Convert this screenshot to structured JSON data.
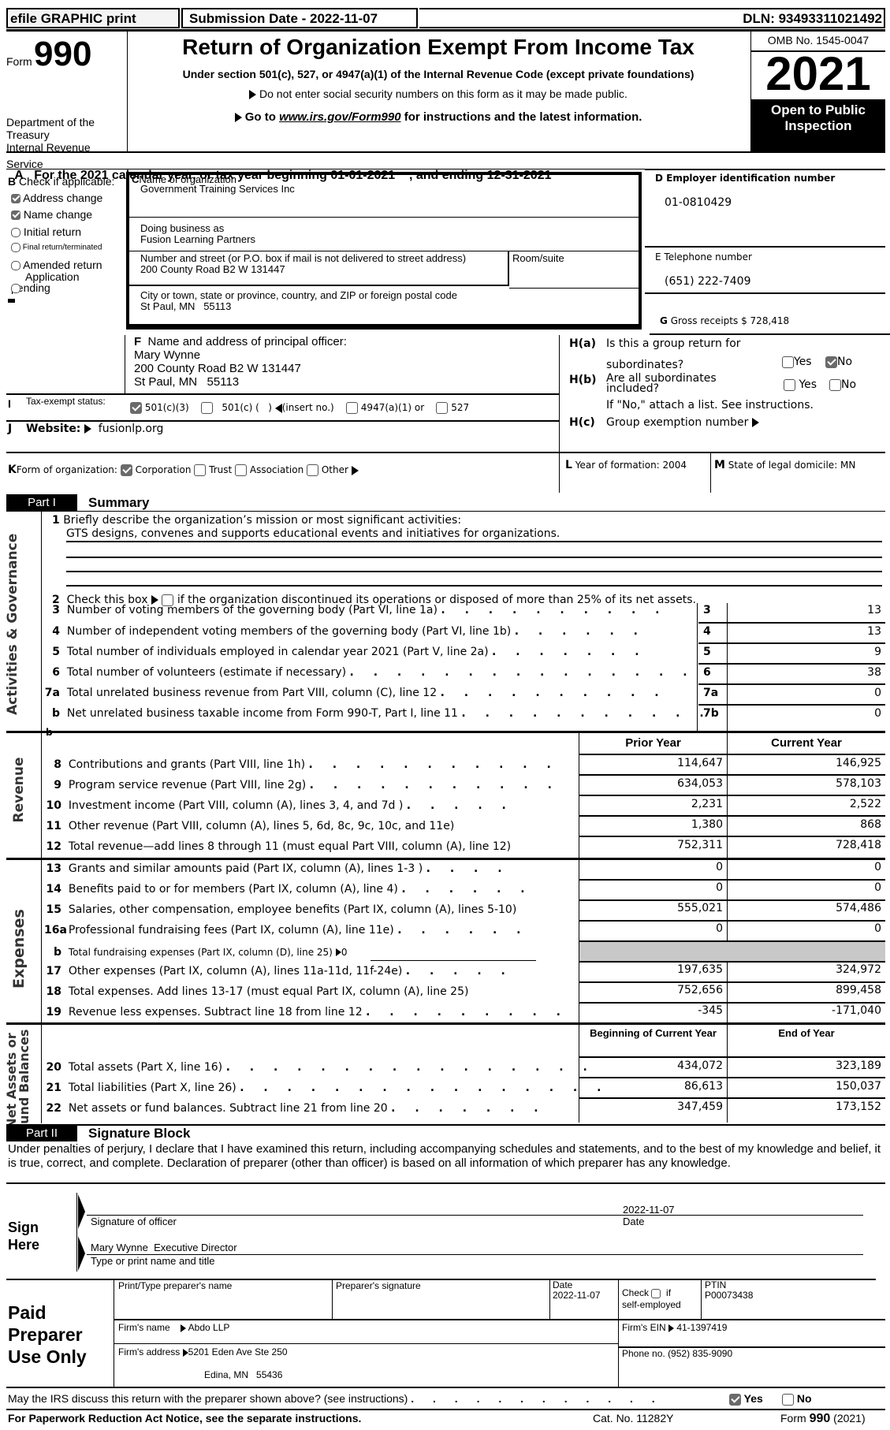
{
  "header": {
    "efile_label": "efile GRAPHIC print",
    "submission_date": "Submission Date - 2022-11-07",
    "dln": "DLN: 93493311021492",
    "form_prefix": "Form",
    "form_number": "990",
    "title": "Return of Organization Exempt From Income Tax",
    "subtitle": "Under section 501(c), 527, or 4947(a)(1) of the Internal Revenue Code (except private foundations)",
    "notice_ssn": "Do not enter social security numbers on this form as it may be made public.",
    "goto_prefix": "Go to ",
    "goto_link": "www.irs.gov/Form990",
    "goto_suffix": " for instructions and the latest information.",
    "dept_line1": "Department of the",
    "dept_line2": "Treasury",
    "dept_line3": "Internal Revenue",
    "dept_line4": "Service",
    "omb": "OMB No. 1545-0047",
    "year": "2021",
    "open_public_1": "Open to Public",
    "open_public_2": "Inspection"
  },
  "line_a": "For the 2021 calendar year, or tax year beginning 01-01-2021    , and ending 12-31-2021",
  "line_a_letter": "A",
  "section_b": {
    "letter": "B",
    "label": "Check if applicable:",
    "items": [
      {
        "label": "Address change",
        "checked": true
      },
      {
        "label": "Name change",
        "checked": true
      },
      {
        "label": "Initial return",
        "checked": false
      },
      {
        "label": "Final return/terminated",
        "checked": false
      },
      {
        "label": "Amended return",
        "checked": false
      },
      {
        "label": "Application pending",
        "checked": false
      }
    ],
    "app_line1": "Application",
    "app_line2": "pending"
  },
  "section_c": {
    "letter": "C",
    "name_label": "Name of organization",
    "name_value": "Government Training Services Inc",
    "dba_label": "Doing business as",
    "dba_value": "Fusion Learning Partners",
    "street_label": "Number and street (or P.O. box if mail is not delivered to street address)",
    "street_value": "200 County Road B2 W 131447",
    "room_label": "Room/suite",
    "city_label": "City or town, state or province, country, and ZIP or foreign postal code",
    "city_value": "St Paul, MN   55113"
  },
  "section_d": {
    "label": "D Employer identification number",
    "value": "01-0810429"
  },
  "section_e": {
    "label": "E Telephone number",
    "value": "(651) 222-7409"
  },
  "section_g": {
    "letter": "G",
    "label": "Gross receipts $",
    "value": "728,418"
  },
  "section_f": {
    "letter": "F",
    "label": "Name and address of principal officer:",
    "name": "Mary Wynne",
    "street": "200 County Road B2 W 131447",
    "city": "St Paul, MN   55113"
  },
  "section_h": {
    "ha_label": "H(a)",
    "ha_text1": "Is this a group return for",
    "ha_text2": "subordinates?",
    "ha_yes": {
      "label": "Yes",
      "checked": false
    },
    "ha_no": {
      "label": "No",
      "checked": true
    },
    "hb_label": "H(b)",
    "hb_text1": "Are all subordinates",
    "hb_text2": "included?",
    "hb_yes": {
      "label": "Yes",
      "checked": false
    },
    "hb_no": {
      "label": "No",
      "checked": false
    },
    "hb_note": "If \"No,\" attach a list. See instructions.",
    "hc_label": "H(c)",
    "hc_text": "Group exemption number"
  },
  "section_i": {
    "letter": "I",
    "label": "Tax-exempt status:",
    "options": [
      {
        "label": "501(c)(3)",
        "checked": true
      },
      {
        "label": "501(c) (   )",
        "checked": false
      },
      {
        "label": "4947(a)(1) or",
        "checked": false
      },
      {
        "label": "527",
        "checked": false
      }
    ],
    "insert_no": "(insert no.)"
  },
  "section_j": {
    "letter": "J",
    "label": "Website:",
    "value": "fusionlp.org"
  },
  "section_k": {
    "letter": "K",
    "label": "Form of organization:",
    "options": [
      {
        "label": "Corporation",
        "checked": true
      },
      {
        "label": "Trust",
        "checked": false
      },
      {
        "label": "Association",
        "checked": false
      },
      {
        "label": "Other",
        "checked": false
      }
    ]
  },
  "section_l": {
    "letter": "L",
    "label": "Year of formation: 2004"
  },
  "section_m": {
    "letter": "M",
    "label": "State of legal domicile: MN"
  },
  "part1": {
    "part_label": "Part I",
    "title": "Summary",
    "side_governance": "Activities & Governance",
    "side_revenue": "Revenue",
    "side_expenses": "Expenses",
    "side_net_assets_1": "Net Assets or",
    "side_net_assets_2": "Fund Balances",
    "line1_num": "1",
    "line1_label": "Briefly describe the organization’s mission or most significant activities:",
    "line1_value": "GTS designs, convenes and supports educational events and initiatives for organizations.",
    "line2_num": "2",
    "line2_label_a": "Check this box",
    "line2_label_b": "if the organization discontinued its operations or disposed of more than 25% of its net assets.",
    "gov_lines": [
      {
        "num": "3",
        "label": "Number of voting members of the governing body (Part VI, line 1a)",
        "dots": ". . . . . . . . . .",
        "box": "3",
        "value": "13"
      },
      {
        "num": "4",
        "label": "Number of independent voting members of the governing body (Part VI, line 1b)",
        "dots": ". . . . . .",
        "box": "4",
        "value": "13"
      },
      {
        "num": "5",
        "label": "Total number of individuals employed in calendar year 2021 (Part V, line 2a)",
        "dots": ". . . . . . .",
        "box": "5",
        "value": "9"
      },
      {
        "num": "6",
        "label": "Total number of volunteers (estimate if necessary)",
        "dots": ". . . . . . . . . . . . . . .",
        "box": "6",
        "value": "38"
      },
      {
        "num": "7a",
        "label": "Total unrelated business revenue from Part VIII, column (C), line 12",
        "dots": ". . . . . . . . . .",
        "box": "7a",
        "value": "0"
      },
      {
        "num": "b",
        "label": "Net unrelated business taxable income from Form 990-T, Part I, line 11",
        "dots": ". . . . . . . . . . .",
        "box": "7b",
        "value": "0"
      }
    ],
    "col_prior": "Prior Year",
    "col_current": "Current Year",
    "revenue_lines": [
      {
        "num": "8",
        "label": "Contributions and grants (Part VIII, line 1h)",
        "dots": ". . . . . . . . . . .",
        "prior": "114,647",
        "current": "146,925"
      },
      {
        "num": "9",
        "label": "Program service revenue (Part VIII, line 2g)",
        "dots": ". . . . . . . . . . .",
        "prior": "634,053",
        "current": "578,103"
      },
      {
        "num": "10",
        "label": "Investment income (Part VIII, column (A), lines 3, 4, and 7d )",
        "dots": ". . . . .",
        "prior": "2,231",
        "current": "2,522"
      },
      {
        "num": "11",
        "label": "Other revenue (Part VIII, column (A), lines 5, 6d, 8c, 9c, 10c, and 11e)",
        "dots": "",
        "prior": "1,380",
        "current": "868"
      },
      {
        "num": "12",
        "label": "Total revenue—add lines 8 through 11 (must equal Part VIII, column (A), line 12)",
        "dots": "",
        "prior": "752,311",
        "current": "728,418"
      }
    ],
    "expense_lines": [
      {
        "num": "13",
        "label": "Grants and similar amounts paid (Part IX, column (A), lines 1-3 )",
        "dots": ". . . .",
        "prior": "0",
        "current": "0"
      },
      {
        "num": "14",
        "label": "Benefits paid to or for members (Part IX, column (A), line 4)",
        "dots": ". . . . . .",
        "prior": "0",
        "current": "0"
      },
      {
        "num": "15",
        "label": "Salaries, other compensation, employee benefits (Part IX, column (A), lines 5-10)",
        "dots": "",
        "prior": "555,021",
        "current": "574,486"
      },
      {
        "num": "16a",
        "label": "Professional fundraising fees (Part IX, column (A), line 11e)",
        "dots": ". . . . . .",
        "prior": "0",
        "current": "0"
      },
      {
        "num": "b",
        "label": "Total fundraising expenses (Part IX, column (D), line 25)",
        "dots": "",
        "prior": "",
        "current": "",
        "inline_value": "0"
      },
      {
        "num": "17",
        "label": "Other expenses (Part IX, column (A), lines 11a-11d, 11f-24e)",
        "dots": ". . . . .",
        "prior": "197,635",
        "current": "324,972"
      },
      {
        "num": "18",
        "label": "Total expenses. Add lines 13-17 (must equal Part IX, column (A), line 25)",
        "dots": "",
        "prior": "752,656",
        "current": "899,458"
      },
      {
        "num": "19",
        "label": "Revenue less expenses. Subtract line 18 from line 12",
        "dots": ". . . . . . . . .",
        "prior": "-345",
        "current": "-171,040"
      }
    ],
    "col_begin": "Beginning of Current Year",
    "col_end": "End of Year",
    "net_lines": [
      {
        "num": "20",
        "label": "Total assets (Part X, line 16)",
        "dots": ". . . . . . . . . . . . . . . .",
        "prior": "434,072",
        "current": "323,189"
      },
      {
        "num": "21",
        "label": "Total liabilities (Part X, line 26)",
        "dots": ". . . . . . . . . . . . . . . .",
        "prior": "86,613",
        "current": "150,037"
      },
      {
        "num": "22",
        "label": "Net assets or fund balances. Subtract line 21 from line 20",
        "dots": ". . . . . . .",
        "prior": "347,459",
        "current": "173,152"
      }
    ]
  },
  "part2": {
    "part_label": "Part II",
    "title": "Signature Block",
    "declaration": "Under penalties of perjury, I declare that I have examined this return, including accompanying schedules and statements, and to the best of my knowledge and belief, it is true, correct, and complete. Declaration of preparer (other than officer) is based on all information of which preparer has any knowledge.",
    "sign_here_1": "Sign",
    "sign_here_2": "Here",
    "sign_date": "2022-11-07",
    "sig_officer_label": "Signature of officer",
    "date_label": "Date",
    "officer_name_title": "Mary Wynne  Executive Director",
    "name_title_label": "Type or print name and title"
  },
  "preparer": {
    "heading_1": "Paid",
    "heading_2": "Preparer",
    "heading_3": "Use Only",
    "name_label": "Print/Type preparer's name",
    "sig_label": "Preparer's signature",
    "date_label": "Date",
    "date_value": "2022-11-07",
    "check_label": "Check",
    "check_if": "if",
    "self_employed": "self-employed",
    "self_employed_checked": false,
    "ptin_label": "PTIN",
    "ptin_value": "P00073438",
    "firm_name_label": "Firm's name",
    "firm_name_value": "Abdo LLP",
    "firm_ein_label": "Firm's EIN",
    "firm_ein_value": "41-1397419",
    "firm_address_label": "Firm's address",
    "firm_address_line1": "5201 Eden Ave Ste 250",
    "firm_address_line2": "Edina, MN   55436",
    "phone_label": "Phone no.",
    "phone_value": "(952) 835-9090"
  },
  "footer": {
    "discuss_question": "May the IRS discuss this return with the preparer shown above? (see instructions)",
    "discuss_dots": ". . . . . . . . . . . .",
    "discuss_yes": {
      "label": "Yes",
      "checked": true
    },
    "discuss_no": {
      "label": "No",
      "checked": false
    },
    "paperwork_notice": "For Paperwork Reduction Act Notice, see the separate instructions.",
    "cat_no": "Cat. No. 11282Y",
    "form_label": "Form",
    "form_number": "990",
    "form_year": "(2021)"
  }
}
